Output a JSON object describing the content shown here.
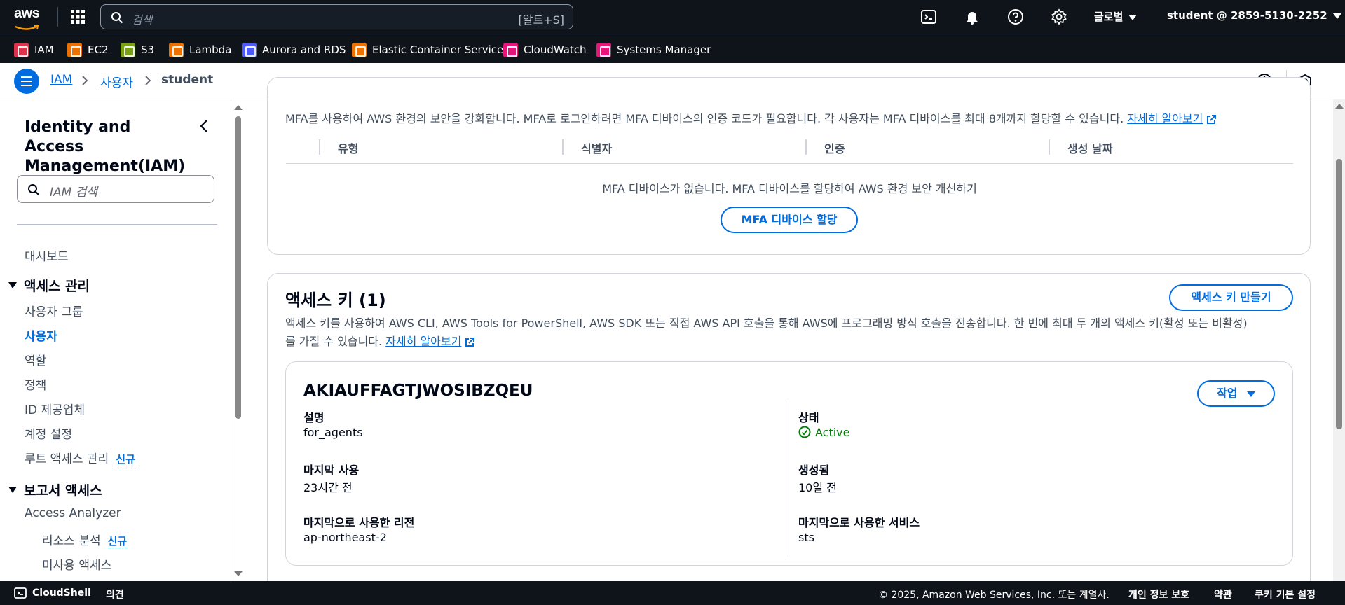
{
  "topbar": {
    "logo": "aws",
    "search_placeholder": "검색",
    "search_shortcut": "[알트+S]",
    "region": "글로벌",
    "account": "student @ 2859-5130-2252"
  },
  "favorites": [
    {
      "label": "IAM",
      "color": "#dd344c"
    },
    {
      "label": "EC2",
      "color": "#ed7100"
    },
    {
      "label": "S3",
      "color": "#7aa116"
    },
    {
      "label": "Lambda",
      "color": "#ed7100"
    },
    {
      "label": "Aurora and RDS",
      "color": "#4d5bf9"
    },
    {
      "label": "Elastic Container Service",
      "color": "#ed7100"
    },
    {
      "label": "CloudWatch",
      "color": "#e7157b"
    },
    {
      "label": "Systems Manager",
      "color": "#e7157b"
    }
  ],
  "breadcrumb": {
    "items": [
      "IAM",
      "사용자",
      "student"
    ]
  },
  "sidebar": {
    "title": "Identity and Access Management(IAM)",
    "search_placeholder": "IAM 검색",
    "dashboard": "대시보드",
    "section_access": "액세스 관리",
    "access_items": [
      "사용자 그룹",
      "사용자",
      "역할",
      "정책",
      "ID 제공업체",
      "계정 설정",
      "루트 액세스 관리"
    ],
    "new_badge": "신규",
    "section_reports": "보고서 액세스",
    "report_items": [
      "Access Analyzer",
      "리소스 분석",
      "미사용 액세스"
    ]
  },
  "mfa": {
    "description": "MFA를 사용하여 AWS 환경의 보안을 강화합니다. MFA로 로그인하려면 MFA 디바이스의 인증 코드가 필요합니다. 각 사용자는 MFA 디바이스를 최대 8개까지 할당할 수 있습니다.",
    "learn_more": "자세히 알아보기",
    "columns": [
      "유형",
      "식별자",
      "인증",
      "생성 날짜"
    ],
    "empty_text": "MFA 디바이스가 없습니다. MFA 디바이스를 할당하여 AWS 환경 보안 개선하기",
    "assign_button": "MFA 디바이스 할당"
  },
  "access_keys": {
    "title": "액세스 키 (1)",
    "create_button": "액세스 키 만들기",
    "description_line1": "액세스 키를 사용하여 AWS CLI, AWS Tools for PowerShell, AWS SDK 또는 직접 AWS API 호출을 통해 AWS에 프로그래밍 방식 호출을 전송합니다. 한 번에 최대 두 개의 액세스 키(활성 또는 비활성)",
    "description_line2": "를 가질 수 있습니다.",
    "learn_more": "자세히 알아보기",
    "key": {
      "id": "AKIAUFFAGTJWOSIBZQEU",
      "actions_button": "작업",
      "desc_label": "설명",
      "desc_value": "for_agents",
      "status_label": "상태",
      "status_value": "Active",
      "last_used_label": "마지막 사용",
      "last_used_value": "23시간 전",
      "created_label": "생성됨",
      "created_value": "10일 전",
      "last_region_label": "마지막으로 사용한 리전",
      "last_region_value": "ap-northeast-2",
      "last_service_label": "마지막으로 사용한 서비스",
      "last_service_value": "sts"
    }
  },
  "footer": {
    "cloudshell": "CloudShell",
    "feedback": "의견",
    "copyright": "© 2025, Amazon Web Services, Inc. 또는 계열사.",
    "privacy": "개인 정보 보호",
    "terms": "약관",
    "cookies": "쿠키 기본 설정"
  }
}
